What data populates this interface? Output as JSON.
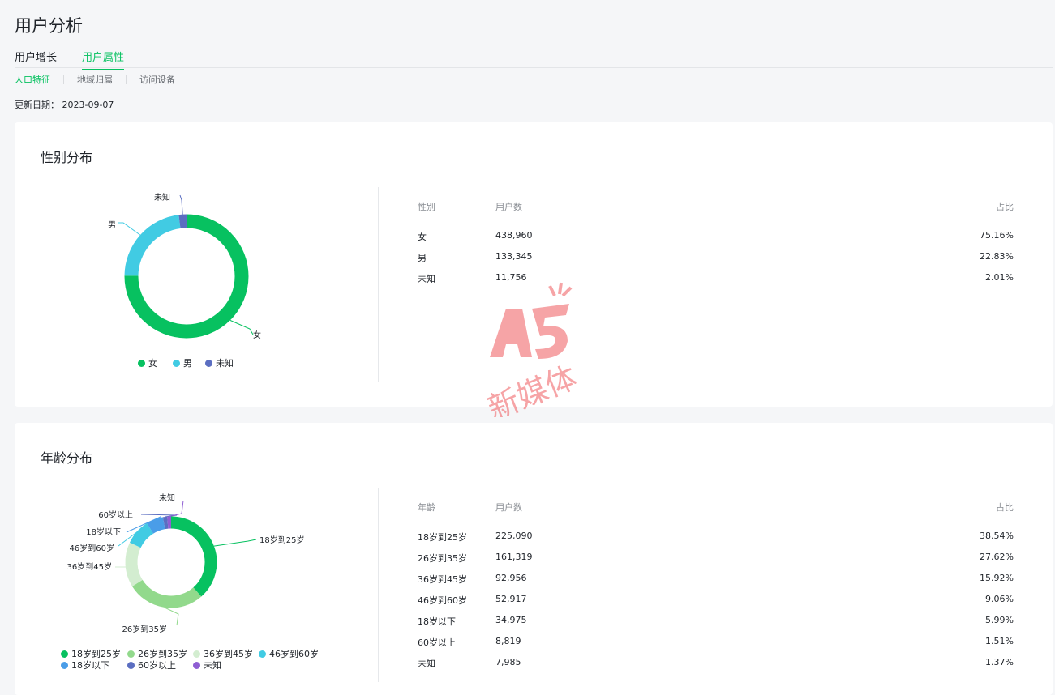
{
  "page": {
    "title": "用户分析",
    "tabs": [
      {
        "label": "用户增长",
        "active": false
      },
      {
        "label": "用户属性",
        "active": true
      }
    ],
    "subtabs": [
      {
        "label": "人口特征",
        "active": true
      },
      {
        "label": "地域归属",
        "active": false
      },
      {
        "label": "访问设备",
        "active": false
      }
    ],
    "update_date": "更新日期： 2023-09-07",
    "accent_color": "#07c160"
  },
  "gender": {
    "title": "性别分布",
    "headers": {
      "category": "性别",
      "users": "用户数",
      "ratio": "占比"
    },
    "rows": [
      {
        "label": "女",
        "users": "438,960",
        "ratio": "75.16%"
      },
      {
        "label": "男",
        "users": "133,345",
        "ratio": "22.83%"
      },
      {
        "label": "未知",
        "users": "11,756",
        "ratio": "2.01%"
      }
    ]
  },
  "age": {
    "title": "年龄分布",
    "headers": {
      "category": "年龄",
      "users": "用户数",
      "ratio": "占比"
    },
    "rows": [
      {
        "label": "18岁到25岁",
        "users": "225,090",
        "ratio": "38.54%"
      },
      {
        "label": "26岁到35岁",
        "users": "161,319",
        "ratio": "27.62%"
      },
      {
        "label": "36岁到45岁",
        "users": "92,956",
        "ratio": "15.92%"
      },
      {
        "label": "46岁到60岁",
        "users": "52,917",
        "ratio": "9.06%"
      },
      {
        "label": "18岁以下",
        "users": "34,975",
        "ratio": "5.99%"
      },
      {
        "label": "60岁以上",
        "users": "8,819",
        "ratio": "1.51%"
      },
      {
        "label": "未知",
        "users": "7,985",
        "ratio": "1.37%"
      }
    ]
  },
  "chart_data": [
    {
      "type": "pie",
      "title": "",
      "categories": [
        "女",
        "男",
        "未知"
      ],
      "values": [
        75.16,
        22.83,
        2.01
      ],
      "colors": [
        "#07c160",
        "#41cbe3",
        "#5b6ec1"
      ],
      "legend": "bottom"
    },
    {
      "type": "pie",
      "title": "",
      "categories": [
        "18岁到25岁",
        "26岁到35岁",
        "36岁到45岁",
        "46岁到60岁",
        "18岁以下",
        "60岁以上",
        "未知"
      ],
      "values": [
        38.54,
        27.62,
        15.92,
        9.06,
        5.99,
        1.51,
        1.37
      ],
      "colors": [
        "#07c160",
        "#92d98c",
        "#d3edd0",
        "#41cbe3",
        "#4a9de8",
        "#5b6ec1",
        "#8f5ed3"
      ],
      "legend": "bottom"
    }
  ],
  "watermark": {
    "logo": "A5",
    "text": "新媒体",
    "color": "#f05a5f"
  }
}
